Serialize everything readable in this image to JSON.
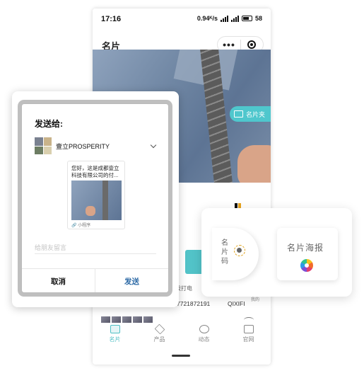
{
  "status_bar": {
    "time": "17:16",
    "network": "0.94ᴷ/s",
    "battery": "58"
  },
  "nav": {
    "title": "名片",
    "more_label": "•••"
  },
  "hero": {
    "tag_label": "名片夹"
  },
  "contact": {
    "phone_action": "拨打电",
    "phone_number": "7721872191",
    "org": "QIXIFI",
    "wode": "我的"
  },
  "tabs": [
    {
      "label": "名片",
      "icon": "card-icon"
    },
    {
      "label": "产品",
      "icon": "layers-icon"
    },
    {
      "label": "动态",
      "icon": "feed-icon"
    },
    {
      "label": "官网",
      "icon": "monitor-icon"
    }
  ],
  "share_dialog": {
    "title": "发送给:",
    "recipient": "壹立PROSPERITY",
    "preview_text": "您好，这是成都壹立科技有限公司的付...",
    "preview_badge": "小程序",
    "message_placeholder": "给朋友留言",
    "cancel_label": "取消",
    "send_label": "发送"
  },
  "float_card": {
    "code_label": "名片码",
    "poster_label": "名片海报"
  },
  "colors": {
    "accent": "#4fc7cd",
    "send": "#2d6aa6",
    "poster_gradient": [
      "#f5c21b",
      "#f26b2a",
      "#e23d6f",
      "#7b4fd6",
      "#2e9ae6",
      "#2fc48e"
    ]
  }
}
